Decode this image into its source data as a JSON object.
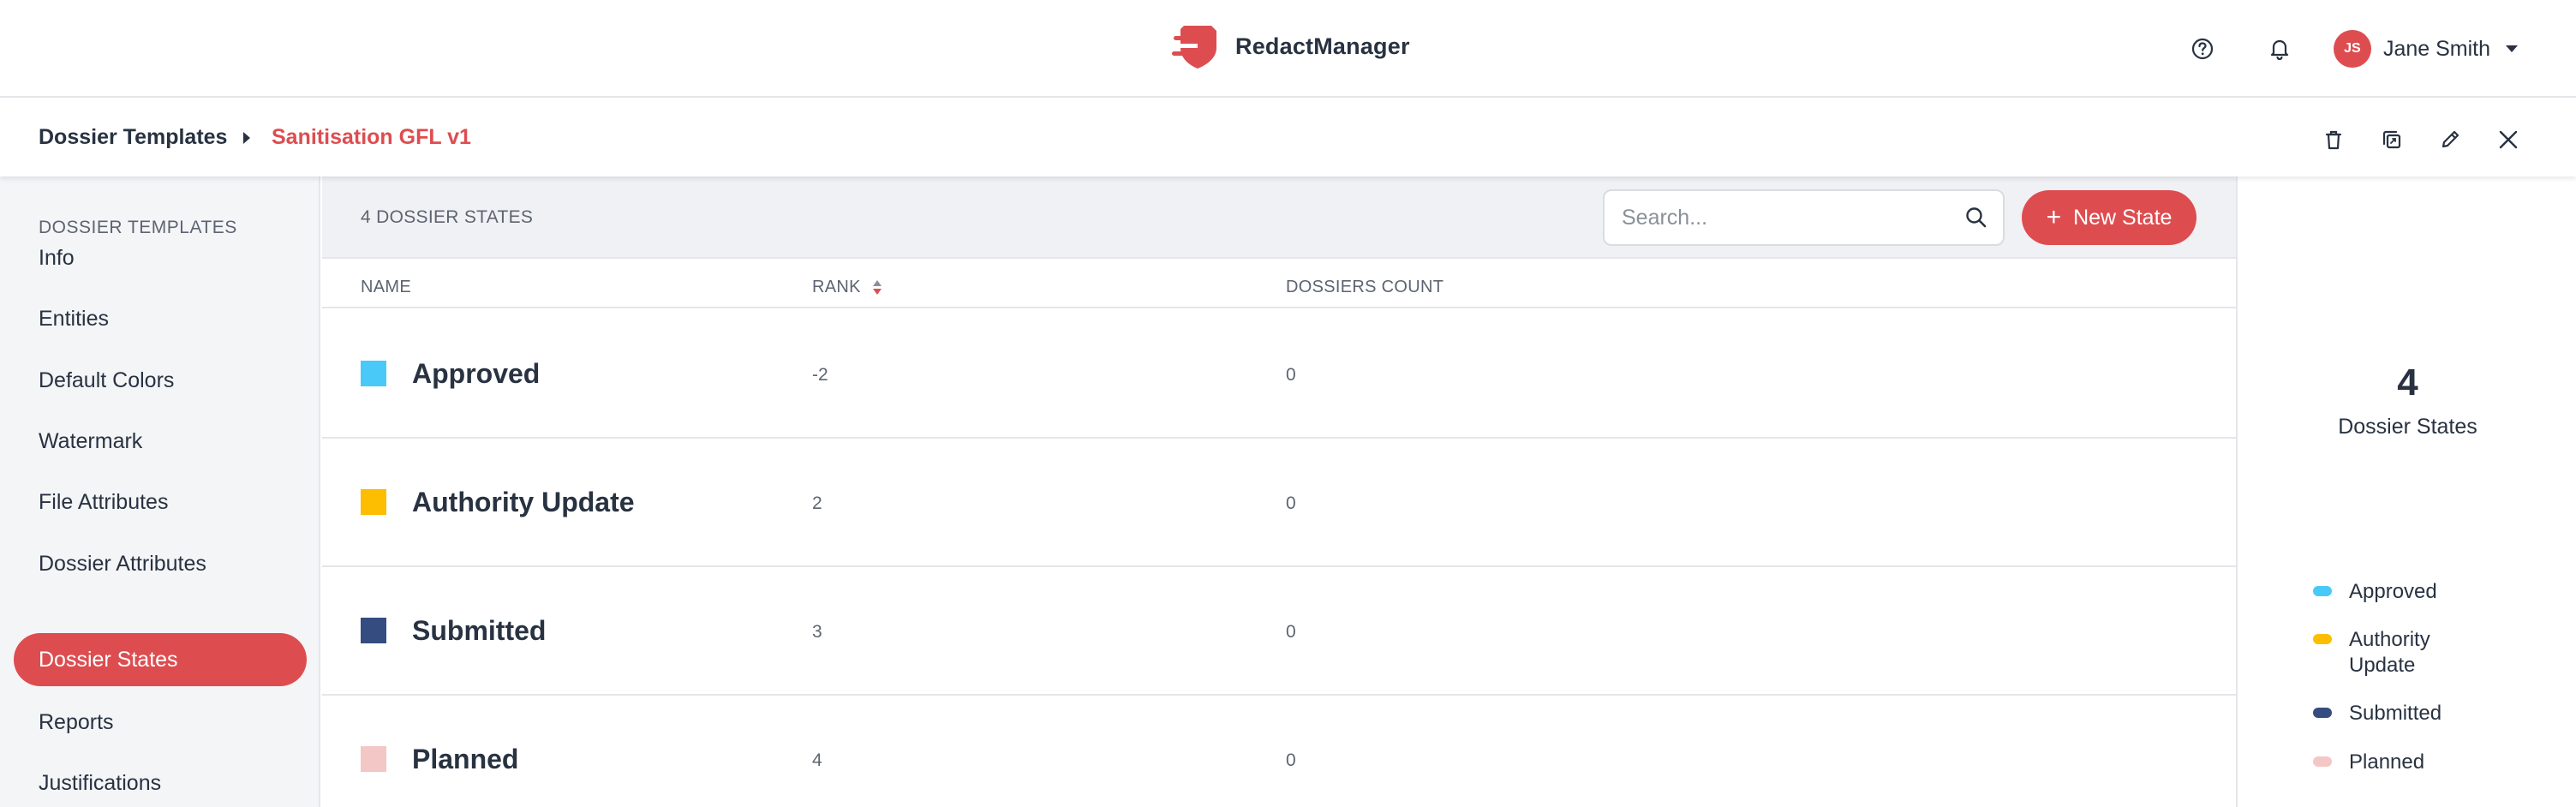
{
  "app": {
    "brand_name": "RedactManager",
    "accent_color": "#dd4d50"
  },
  "header": {
    "help_icon": "help-circle-icon",
    "notification_icon": "bell-icon",
    "user": {
      "initials": "JS",
      "name": "Jane Smith"
    }
  },
  "breadcrumb": {
    "root": "Dossier Templates",
    "current": "Sanitisation GFL v1",
    "actions": [
      "trash-icon",
      "duplicate-icon",
      "edit-icon",
      "close-icon"
    ]
  },
  "sidebar": {
    "heading": "DOSSIER TEMPLATES",
    "items": [
      {
        "label": "Info",
        "active": false
      },
      {
        "label": "Entities",
        "active": false
      },
      {
        "label": "Default Colors",
        "active": false
      },
      {
        "label": "Watermark",
        "active": false
      },
      {
        "label": "File Attributes",
        "active": false
      },
      {
        "label": "Dossier Attributes",
        "active": false
      },
      {
        "label": "Dossier States",
        "active": true
      },
      {
        "label": "Reports",
        "active": false
      },
      {
        "label": "Justifications",
        "active": false
      }
    ]
  },
  "list": {
    "title": "4 DOSSIER STATES",
    "search_placeholder": "Search...",
    "new_button_label": "New State",
    "columns": {
      "name": "NAME",
      "rank": "RANK",
      "count": "DOSSIERS COUNT"
    },
    "rows": [
      {
        "name": "Approved",
        "rank": "-2",
        "count": "0",
        "color": "#48c9f7"
      },
      {
        "name": "Authority Update",
        "rank": "2",
        "count": "0",
        "color": "#fdbd00"
      },
      {
        "name": "Submitted",
        "rank": "3",
        "count": "0",
        "color": "#354c81"
      },
      {
        "name": "Planned",
        "rank": "4",
        "count": "0",
        "color": "#f3c7c5"
      }
    ]
  },
  "stats": {
    "total": "4",
    "label": "Dossier States",
    "legend": [
      {
        "label": "Approved",
        "color": "#48c9f7"
      },
      {
        "label": "Authority Update",
        "color": "#fdbd00"
      },
      {
        "label": "Submitted",
        "color": "#354c81"
      },
      {
        "label": "Planned",
        "color": "#f3c7c5"
      }
    ]
  }
}
